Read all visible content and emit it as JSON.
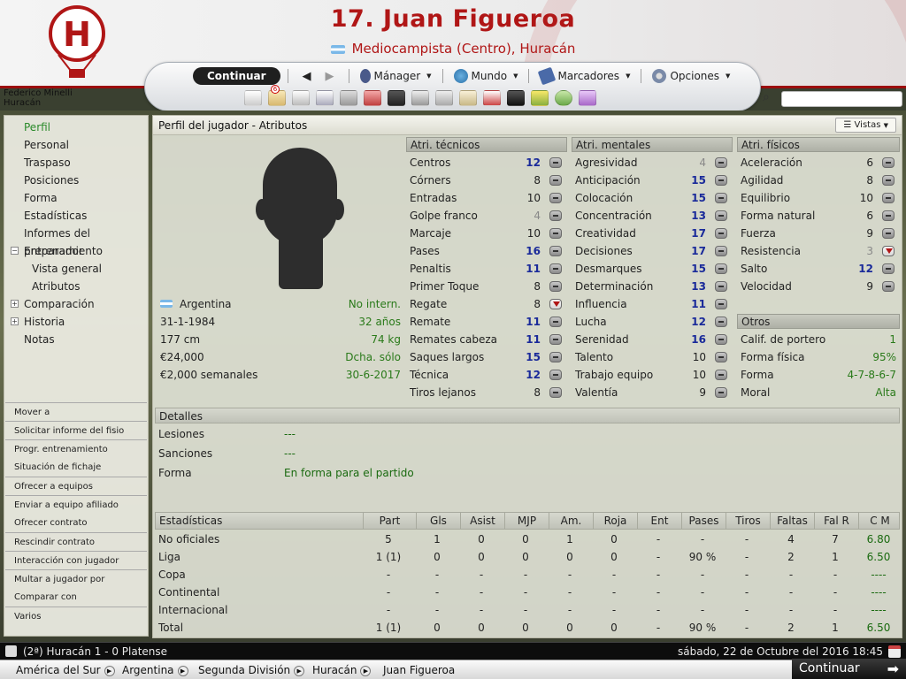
{
  "header": {
    "player_title": "17. Juan Figueroa",
    "player_subtitle": "Mediocampista (Centro), Huracán",
    "club_logo_letter": "H",
    "colors": {
      "accent": "#b01616",
      "attr_high": "#1a2a9a",
      "positive": "#2a7a1a"
    }
  },
  "nav": {
    "continue": "Continuar",
    "back_icon": "arrow-left-icon",
    "forward_icon": "arrow-right-icon",
    "menus": [
      "Mánager",
      "Mundo",
      "Marcadores",
      "Opciones"
    ],
    "toolbar_badge": "6"
  },
  "manager": {
    "name": "Federico Minelli",
    "club": "Huracán"
  },
  "sidebar": {
    "items": [
      "Perfil",
      "Personal",
      "Traspaso",
      "Posiciones",
      "Forma",
      "Estadísticas",
      "Informes del preparador",
      "Entrenamiento",
      "Vista general",
      "Atributos",
      "Comparación",
      "Historia",
      "Notas"
    ],
    "actions": [
      "Mover a",
      "Solicitar informe del fisio",
      "Progr. entrenamiento",
      "Situación de fichaje",
      "Ofrecer a equipos",
      "Enviar a equipo afiliado",
      "Ofrecer contrato",
      "Rescindir contrato",
      "Interacción con jugador",
      "Multar a jugador por",
      "Comparar con",
      "Varios"
    ]
  },
  "panel": {
    "title": "Perfil del jugador - Atributos",
    "views": "Vistas"
  },
  "bio": {
    "nationality": "Argentina",
    "intl": "No intern.",
    "dob": "31-1-1984",
    "age": "32 años",
    "height": "177 cm",
    "weight": "74 kg",
    "value": "€24,000",
    "foot": "Dcha. sólo",
    "wage": "€2,000 semanales",
    "contract": "30-6-2017"
  },
  "attributes": {
    "technical_title": "Atri. técnicos",
    "technical": [
      {
        "n": "Centros",
        "v": "12"
      },
      {
        "n": "Córners",
        "v": "8"
      },
      {
        "n": "Entradas",
        "v": "10"
      },
      {
        "n": "Golpe franco",
        "v": "4"
      },
      {
        "n": "Marcaje",
        "v": "10"
      },
      {
        "n": "Pases",
        "v": "16"
      },
      {
        "n": "Penaltis",
        "v": "11"
      },
      {
        "n": "Primer Toque",
        "v": "8"
      },
      {
        "n": "Regate",
        "v": "8"
      },
      {
        "n": "Remate",
        "v": "11"
      },
      {
        "n": "Remates cabeza",
        "v": "11"
      },
      {
        "n": "Saques largos",
        "v": "15"
      },
      {
        "n": "Técnica",
        "v": "12"
      },
      {
        "n": "Tiros lejanos",
        "v": "8"
      }
    ],
    "mental_title": "Atri. mentales",
    "mental": [
      {
        "n": "Agresividad",
        "v": "4"
      },
      {
        "n": "Anticipación",
        "v": "15"
      },
      {
        "n": "Colocación",
        "v": "15"
      },
      {
        "n": "Concentración",
        "v": "13"
      },
      {
        "n": "Creatividad",
        "v": "17"
      },
      {
        "n": "Decisiones",
        "v": "17"
      },
      {
        "n": "Desmarques",
        "v": "15"
      },
      {
        "n": "Determinación",
        "v": "13"
      },
      {
        "n": "Influencia",
        "v": "11"
      },
      {
        "n": "Lucha",
        "v": "12"
      },
      {
        "n": "Serenidad",
        "v": "16"
      },
      {
        "n": "Talento",
        "v": "10"
      },
      {
        "n": "Trabajo equipo",
        "v": "10"
      },
      {
        "n": "Valentía",
        "v": "9"
      }
    ],
    "physical_title": "Atri. físicos",
    "physical": [
      {
        "n": "Aceleración",
        "v": "6"
      },
      {
        "n": "Agilidad",
        "v": "8"
      },
      {
        "n": "Equilibrio",
        "v": "10"
      },
      {
        "n": "Forma natural",
        "v": "6"
      },
      {
        "n": "Fuerza",
        "v": "9"
      },
      {
        "n": "Resistencia",
        "v": "3"
      },
      {
        "n": "Salto",
        "v": "12"
      },
      {
        "n": "Velocidad",
        "v": "9"
      }
    ],
    "others_title": "Otros",
    "others": [
      {
        "n": "Calif. de portero",
        "v": "1"
      },
      {
        "n": "Forma física",
        "v": "95%"
      },
      {
        "n": "Forma",
        "v": "4-7-8-6-7"
      },
      {
        "n": "Moral",
        "v": "Alta"
      }
    ]
  },
  "details": {
    "title": "Detalles",
    "rows": [
      {
        "l": "Lesiones",
        "v": "---"
      },
      {
        "l": "Sanciones",
        "v": "---"
      },
      {
        "l": "Forma",
        "v": "En forma para el partido"
      }
    ]
  },
  "stats": {
    "headers": [
      "Estadísticas",
      "Part",
      "Gls",
      "Asist",
      "MJP",
      "Am.",
      "Roja",
      "Ent",
      "Pases",
      "Tiros",
      "Faltas",
      "Fal R",
      "C M"
    ],
    "rows": [
      [
        "No oficiales",
        "5",
        "1",
        "0",
        "0",
        "1",
        "0",
        "-",
        "-",
        "-",
        "4",
        "7",
        "6.80"
      ],
      [
        "Liga",
        "1 (1)",
        "0",
        "0",
        "0",
        "0",
        "0",
        "-",
        "90 %",
        "-",
        "2",
        "1",
        "6.50"
      ],
      [
        "Copa",
        "-",
        "-",
        "-",
        "-",
        "-",
        "-",
        "-",
        "-",
        "-",
        "-",
        "-",
        "----"
      ],
      [
        "Continental",
        "-",
        "-",
        "-",
        "-",
        "-",
        "-",
        "-",
        "-",
        "-",
        "-",
        "-",
        "----"
      ],
      [
        "Internacional",
        "-",
        "-",
        "-",
        "-",
        "-",
        "-",
        "-",
        "-",
        "-",
        "-",
        "-",
        "----"
      ],
      [
        "Total",
        "1 (1)",
        "0",
        "0",
        "0",
        "0",
        "0",
        "-",
        "90 %",
        "-",
        "2",
        "1",
        "6.50"
      ]
    ]
  },
  "status": {
    "score": "(2ª) Huracán 1 - 0 Platense",
    "datetime": "sábado, 22 de Octubre del 2016 18:45"
  },
  "breadcrumb": [
    "América del Sur",
    "Argentina",
    "Segunda División",
    "Huracán",
    "Juan Figueroa"
  ],
  "continue_bottom": "Continuar"
}
